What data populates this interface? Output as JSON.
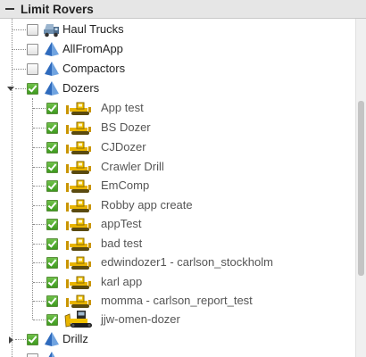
{
  "panel": {
    "title": "Limit Rovers"
  },
  "colors": {
    "check_green": "#3e9a1f",
    "pyramid_blue": "#2f6bbd",
    "dozer_yellow": "#e8b400"
  },
  "tree": {
    "groups": [
      {
        "label": "Haul Trucks",
        "checked": false,
        "icon": "truck-icon",
        "expanded": false
      },
      {
        "label": "AllFromApp",
        "checked": false,
        "icon": "pyramid-icon",
        "expanded": false
      },
      {
        "label": "Compactors",
        "checked": false,
        "icon": "pyramid-icon",
        "expanded": false
      },
      {
        "label": "Dozers",
        "checked": true,
        "icon": "pyramid-icon",
        "expanded": true,
        "children": [
          {
            "label": "App test",
            "checked": true,
            "icon": "dozer-icon"
          },
          {
            "label": "BS Dozer",
            "checked": true,
            "icon": "dozer-icon"
          },
          {
            "label": "CJDozer",
            "checked": true,
            "icon": "dozer-icon"
          },
          {
            "label": "Crawler Drill",
            "checked": true,
            "icon": "dozer-icon"
          },
          {
            "label": "EmComp",
            "checked": true,
            "icon": "dozer-icon"
          },
          {
            "label": "Robby app create",
            "checked": true,
            "icon": "dozer-icon"
          },
          {
            "label": "appTest",
            "checked": true,
            "icon": "dozer-icon"
          },
          {
            "label": "bad test",
            "checked": true,
            "icon": "dozer-icon"
          },
          {
            "label": "edwindozer1 - carlson_stockholm",
            "checked": true,
            "icon": "dozer-icon"
          },
          {
            "label": "karl app",
            "checked": true,
            "icon": "dozer-icon"
          },
          {
            "label": "momma - carlson_report_test",
            "checked": true,
            "icon": "dozer-icon"
          },
          {
            "label": "jjw-omen-dozer",
            "checked": true,
            "icon": "dozer-3d-icon"
          }
        ]
      },
      {
        "label": "Drillz",
        "checked": true,
        "icon": "pyramid-icon",
        "expanded": false
      }
    ]
  }
}
